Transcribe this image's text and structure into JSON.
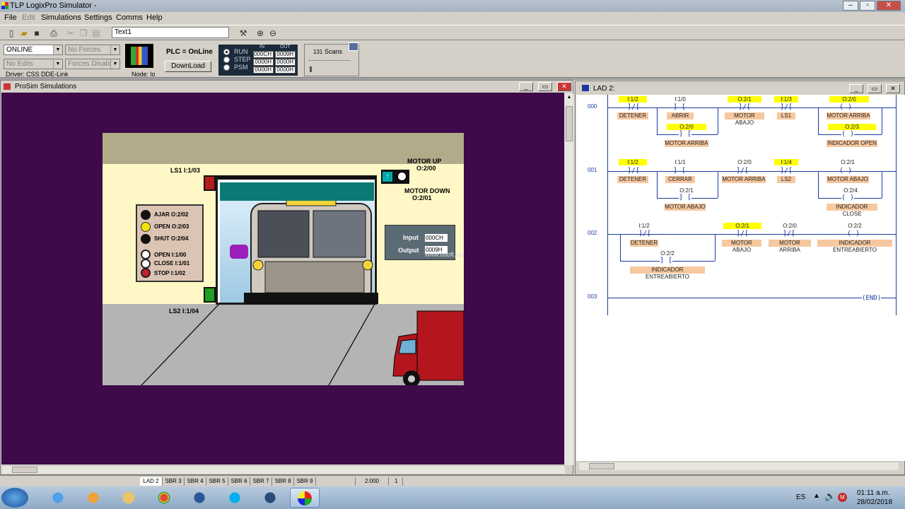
{
  "app": {
    "title": "TLP LogixPro Simulator  -"
  },
  "menu": {
    "items": [
      "File",
      "Edit",
      "Simulations",
      "Settings",
      "Comms",
      "Help"
    ]
  },
  "toolbar": {
    "text_field": "Text1"
  },
  "plc": {
    "mode": "ONLINE",
    "edits": "No Edits",
    "forces": "No Forces",
    "forces_state": "Forces Disabled",
    "driver": "Driver: CSS DDE-Link",
    "node": "Node: lo",
    "status": "PLC = OnLine",
    "download_label": "DownLoad",
    "run": "RUN",
    "step": "STEP",
    "psm": "PSM",
    "in_header": "IN",
    "out_header": "OUT",
    "regs": {
      "r1_in": "000CH",
      "r1_out": "0009H",
      "r2_in": "0000H",
      "r2_out": "0000H",
      "r3_in": "0000H",
      "r3_out": "0000H"
    },
    "scans_value": "131",
    "scans_label": "Scans"
  },
  "prosim": {
    "title": "ProSim Simulations",
    "ls1": "LS1   I:1/03",
    "ls2": "LS2   I:1/04",
    "motor_up": "MOTOR UP",
    "motor_up_addr": "O:2/00",
    "motor_down": "MOTOR DOWN",
    "motor_down_addr": "O:2/01",
    "panel": {
      "ajar": "AJAR  O:2/02",
      "open_light": "OPEN  O:2/03",
      "shut": "SHUT  O:2/04",
      "open_btn": "OPEN    I:1/00",
      "close_btn": "CLOSE I:1/01",
      "stop_btn": "STOP    I:1/02"
    },
    "io_input": "Input",
    "io_input_val": "000CH",
    "io_output": "Output",
    "io_output_val": "0009H",
    "watermark": "www.dsoft.com"
  },
  "ladder": {
    "title": "LAD 2:",
    "rungs": [
      {
        "num": "000",
        "elems": [
          {
            "addr": "I:1/2",
            "desc": "DETENER"
          },
          {
            "addr": "I:1/0",
            "desc": "ABRIR"
          },
          {
            "addr": "O:2/1",
            "desc": "MOTOR ABAJO"
          },
          {
            "addr": "I:1/3",
            "desc": "LS1"
          },
          {
            "addr": "O:2/0",
            "desc": "MOTOR ARRIBA"
          },
          {
            "addr": "O:2/0",
            "desc": "MOTOR ARRIBA"
          },
          {
            "addr": "O:2/3",
            "desc": "INDICADOR OPEN"
          }
        ]
      },
      {
        "num": "001",
        "elems": [
          {
            "addr": "I:1/2",
            "desc": "DETENER"
          },
          {
            "addr": "I:1/1",
            "desc": "CERRAR"
          },
          {
            "addr": "O:2/0",
            "desc": "MOTOR ARRIBA"
          },
          {
            "addr": "I:1/4",
            "desc": "LS2"
          },
          {
            "addr": "O:2/1",
            "desc": "MOTOR ABAJO"
          },
          {
            "addr": "O:2/1",
            "desc": "MOTOR ABAJO"
          },
          {
            "addr": "O:2/4",
            "desc": "INDICADOR CLOSE"
          }
        ]
      },
      {
        "num": "002",
        "elems": [
          {
            "addr": "I:1/2",
            "desc": "DETENER"
          },
          {
            "addr": "O:2/1",
            "desc": "MOTOR ABAJO"
          },
          {
            "addr": "O:2/0",
            "desc": "MOTOR ARRIBA"
          },
          {
            "addr": "O:2/2",
            "desc": "INDICADOR ENTREABIERTO"
          },
          {
            "addr": "O:2/2",
            "desc": "INDICADOR ENTREABIERTO"
          }
        ]
      },
      {
        "num": "003",
        "end": "END"
      }
    ]
  },
  "statusbar": {
    "tabs": [
      "LAD 2",
      "SBR 3",
      "SBR 4",
      "SBR 5",
      "SBR 6",
      "SBR 7",
      "SBR 8",
      "SBR 9"
    ],
    "addr": "2:000",
    "count": "1"
  },
  "taskbar": {
    "lang": "ES",
    "time": "01:11 a.m.",
    "date": "28/02/2018"
  }
}
